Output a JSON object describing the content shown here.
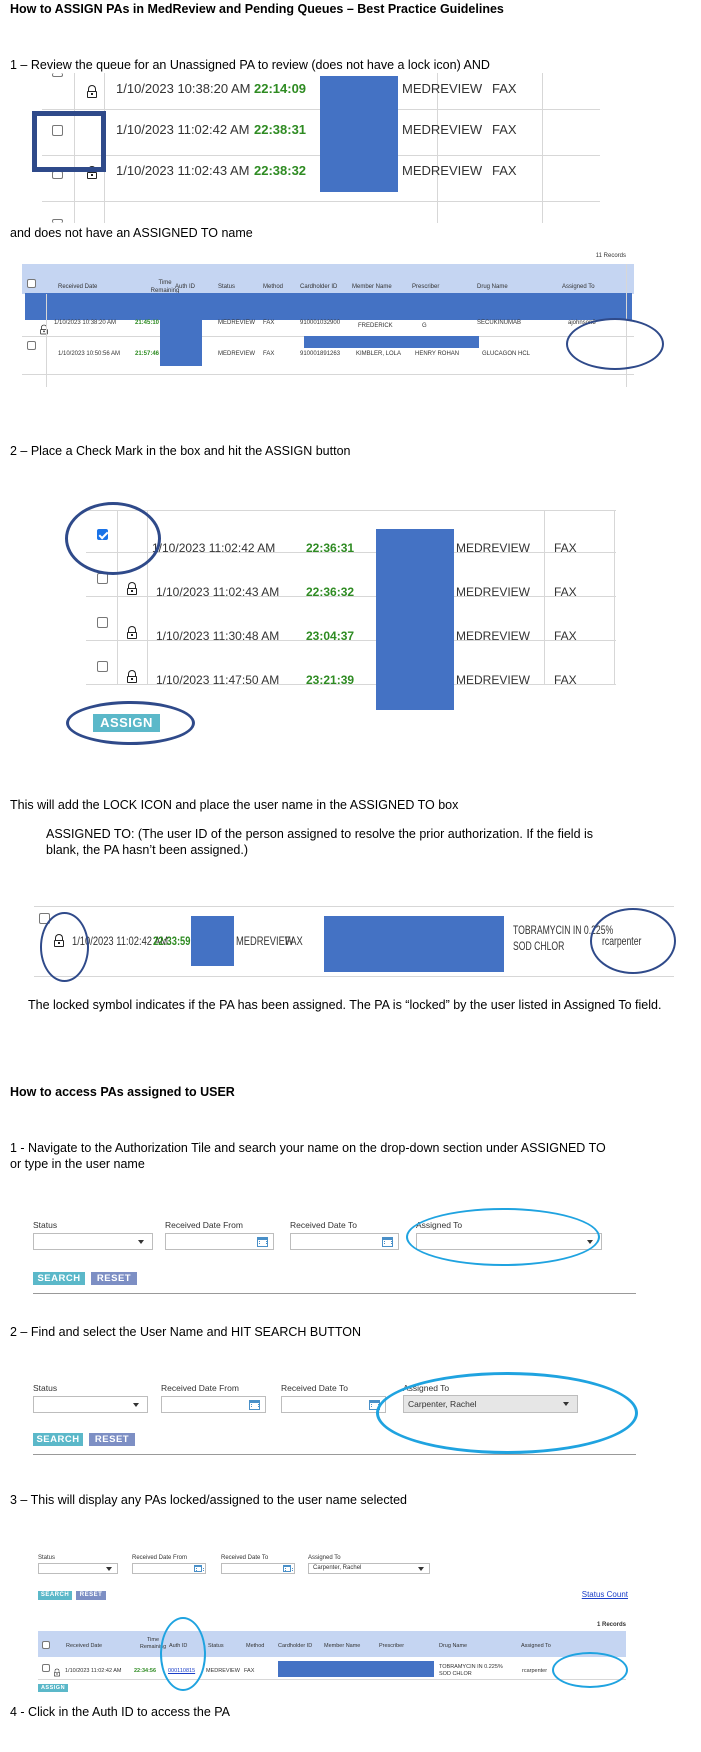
{
  "doc": {
    "title": "How to ASSIGN PAs in MedReview and Pending Queues – Best Practice Guidelines",
    "step1": "1 – Review the queue for an Unassigned PA to review (does not have a lock icon) AND",
    "step1b": "and does not have an ASSIGNED TO name",
    "step2": "2 – Place a Check Mark in the box and hit the ASSIGN button",
    "lock_note": "This will add the LOCK ICON and place the user name in the ASSIGNED TO box",
    "assigned_def": "ASSIGNED TO: (The user ID of the person assigned to resolve the prior authorization. If the field is blank, the PA hasn’t been assigned.)",
    "locked_symbol": "The locked symbol indicates if the PA has been assigned. The PA is “locked” by the user listed in Assigned To field.",
    "section2_title": "How to access PAs assigned to USER",
    "access1": "1 - Navigate to the Authorization Tile and search your name on the drop-down section under ASSIGNED TO or type in the user name",
    "access2": "2 – Find and select the User Name and HIT SEARCH BUTTON",
    "access3": "3 – This will display any PAs locked/assigned to the user name selected",
    "access4": "4 - Click in the Auth ID to access the PA"
  },
  "shot1": {
    "rows": [
      {
        "date": "1/10/2023 10:38:20 AM",
        "time": "22:14:09",
        "method": "MEDREVIEW",
        "channel": "FAX"
      },
      {
        "date": "1/10/2023 11:02:42 AM",
        "time": "22:38:31",
        "method": "MEDREVIEW",
        "channel": "FAX"
      },
      {
        "date": "1/10/2023 11:02:43 AM",
        "time": "22:38:32",
        "method": "MEDREVIEW",
        "channel": "FAX"
      }
    ]
  },
  "shot2": {
    "records": "11 Records",
    "headers": [
      "Received Date",
      "Time Remaining",
      "Auth ID",
      "Status",
      "Method",
      "Cardholder ID",
      "Member Name",
      "Prescriber",
      "Drug Name",
      "Assigned To"
    ],
    "row1": {
      "date": "1/10/2023 10:38:20 AM",
      "time": "21:45:10",
      "status": "MEDREVIEW",
      "method": "FAX",
      "cardholder": "910001032900",
      "member": "FREDERICK",
      "prescriber": "G",
      "drug": "SECUKINUMAB",
      "assigned": "ajohnson3"
    },
    "row2": {
      "date": "1/10/2023 10:50:56 AM",
      "time": "21:57:46",
      "status": "MEDREVIEW",
      "method": "FAX",
      "cardholder": "910001891263",
      "member": "KIMBLER, LOLA",
      "prescriber": "HENRY ROHAN",
      "drug": "GLUCAGON HCL"
    }
  },
  "shot3": {
    "rows": [
      {
        "date": "1/10/2023 11:02:42 AM",
        "time": "22:36:31",
        "method": "MEDREVIEW",
        "channel": "FAX"
      },
      {
        "date": "1/10/2023 11:02:43 AM",
        "time": "22:36:32",
        "method": "MEDREVIEW",
        "channel": "FAX"
      },
      {
        "date": "1/10/2023 11:30:48 AM",
        "time": "23:04:37",
        "method": "MEDREVIEW",
        "channel": "FAX"
      },
      {
        "date": "1/10/2023 11:47:50 AM",
        "time": "23:21:39",
        "method": "MEDREVIEW",
        "channel": "FAX"
      }
    ],
    "assign_label": "ASSIGN"
  },
  "shot4": {
    "date": "1/10/2023 11:02:42 AM",
    "time": "22:33:59",
    "method": "MEDREVIEW",
    "channel": "FAX",
    "drug1": "TOBRAMYCIN IN 0.225%",
    "drug2": "SOD CHLOR",
    "assigned": "rcarpenter"
  },
  "filters": {
    "status": "Status",
    "from": "Received Date From",
    "to": "Received Date To",
    "assigned": "Assigned To",
    "search": "SEARCH",
    "reset": "RESET",
    "selected_user": "Carpenter, Rachel"
  },
  "shot7": {
    "status_count": "Status Count",
    "records": "1 Records",
    "headers": [
      "Received Date",
      "Time Remaining",
      "Auth ID",
      "Status",
      "Method",
      "Cardholder ID",
      "Member Name",
      "Prescriber",
      "Drug Name",
      "Assigned To"
    ],
    "date": "1/10/2023 11:02:42 AM",
    "time": "22:34:56",
    "auth_id": "000110815",
    "status": "MEDREVIEW",
    "method": "FAX",
    "drug1": "TOBRAMYCIN IN 0.225%",
    "drug2": "SOD CHLOR",
    "assigned": "rcarpenter",
    "assign_label": "ASSIGN"
  },
  "colors": {
    "highlight_ring": "#2f4a8a",
    "cyan_ring": "#1fa3e0",
    "redaction": "#4472c4",
    "timer": "#2e8b22",
    "header_band": "#c5d5f2"
  }
}
